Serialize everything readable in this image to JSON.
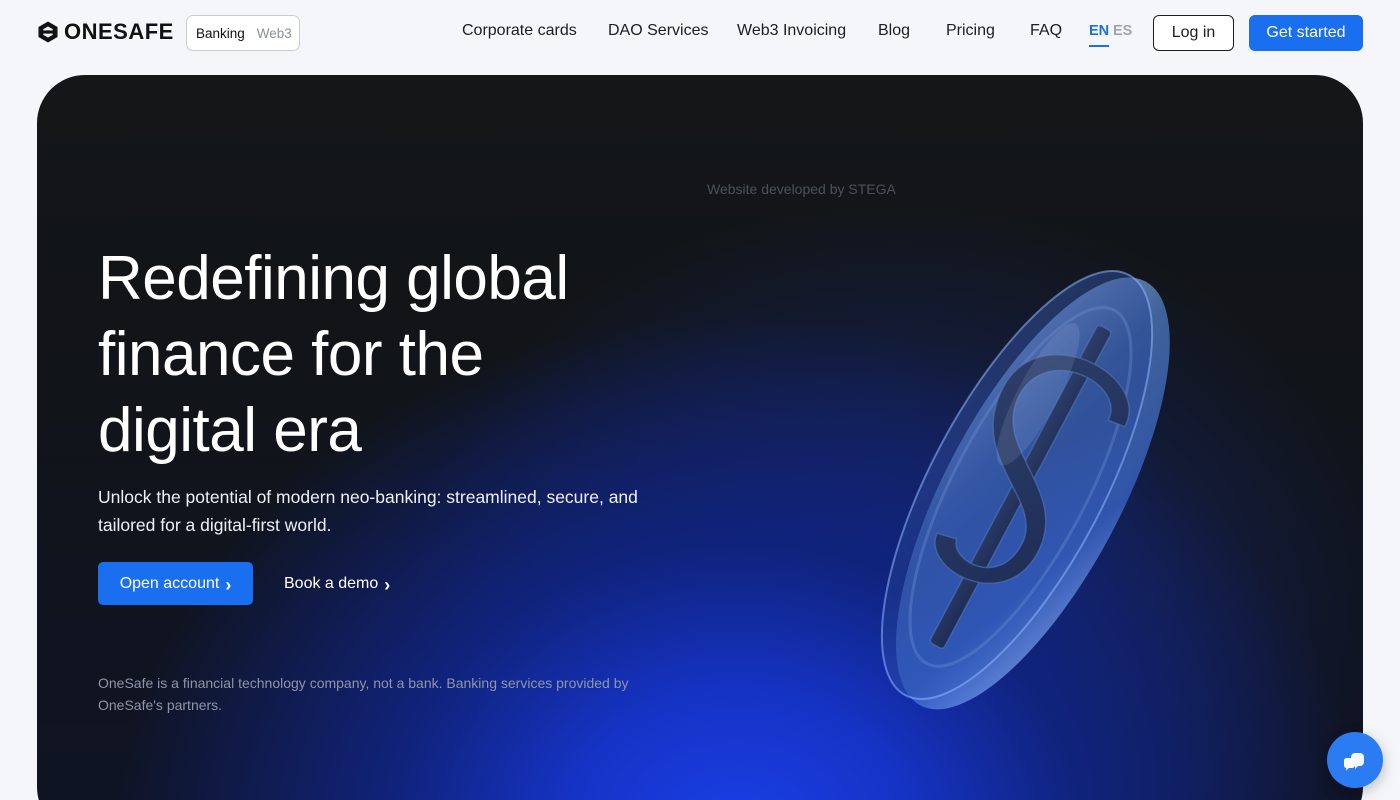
{
  "header": {
    "logo_text": "ONESAFE",
    "mode_toggle": {
      "active": "Banking",
      "inactive": "Web3"
    },
    "nav": [
      {
        "label": "Corporate cards"
      },
      {
        "label": "DAO Services"
      },
      {
        "label": "Web3 Invoicing"
      },
      {
        "label": "Blog"
      },
      {
        "label": "Pricing"
      },
      {
        "label": "FAQ"
      }
    ],
    "languages": {
      "active": "EN",
      "inactive": "ES"
    },
    "login_label": "Log in",
    "get_started_label": "Get started"
  },
  "hero": {
    "credit": "Website developed by STEGA",
    "title": "Redefining global finance for the digital era",
    "subtitle": "Unlock the potential of modern neo-banking: streamlined, secure, and tailored for a digital-first world.",
    "primary_cta": "Open account",
    "secondary_cta": "Book a demo",
    "disclaimer": "OneSafe is a financial technology company, not a bank. Banking services provided by OneSafe's partners."
  },
  "icons": {
    "logo": "hexagon-logo-icon",
    "chevron": "chevron-right-icon",
    "chat": "chat-bubbles-icon",
    "hero_image": "glass-dollar-coin"
  },
  "colors": {
    "accent": "#1a6ff0",
    "hero_dark": "#111418",
    "hero_glow": "#1a3fe8"
  }
}
